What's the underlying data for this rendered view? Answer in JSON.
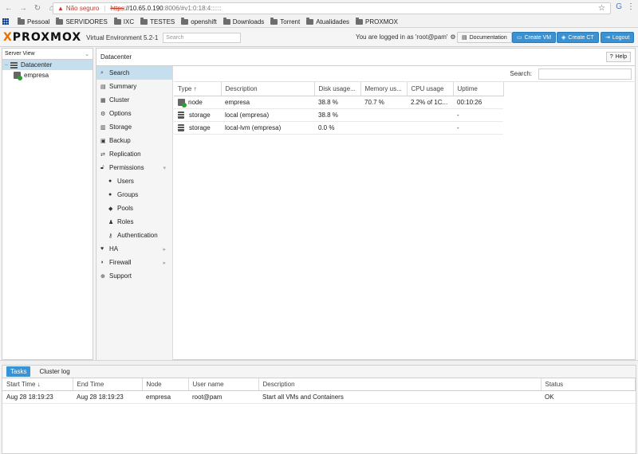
{
  "browser": {
    "insecure_label": "Não seguro",
    "url_scheme": "https",
    "url_host": "://10.65.0.190",
    "url_rest": ":8006/#v1:0:18:4::::::",
    "bookmarks": [
      "Pessoal",
      "SERVIDORES",
      "IXC",
      "TESTES",
      "openshift",
      "Downloads",
      "Torrent",
      "Atualidades",
      "PROXMOX"
    ]
  },
  "header": {
    "logo_pre": "",
    "logo_x": "X",
    "logo_text": "PROXMOX",
    "ve_title": "Virtual Environment 5.2-1",
    "search_placeholder": "Search",
    "logged_in": "You are logged in as 'root@pam'",
    "doc_label": "Documentation",
    "create_vm": "Create VM",
    "create_ct": "Create CT",
    "logout": "Logout"
  },
  "tree": {
    "view": "Server View",
    "datacenter": "Datacenter",
    "node": "empresa"
  },
  "content": {
    "title": "Datacenter",
    "help": "Help",
    "menu": [
      {
        "label": "Search",
        "icon": "search-icon"
      },
      {
        "label": "Summary",
        "icon": "summary-icon"
      },
      {
        "label": "Cluster",
        "icon": "cluster-icon"
      },
      {
        "label": "Options",
        "icon": "gear-icon"
      },
      {
        "label": "Storage",
        "icon": "storage-icon"
      },
      {
        "label": "Backup",
        "icon": "backup-icon"
      },
      {
        "label": "Replication",
        "icon": "replication-icon"
      },
      {
        "label": "Permissions",
        "icon": "unlock-icon"
      },
      {
        "label": "Users",
        "icon": "user-icon"
      },
      {
        "label": "Groups",
        "icon": "users-icon"
      },
      {
        "label": "Pools",
        "icon": "tags-icon"
      },
      {
        "label": "Roles",
        "icon": "male-icon"
      },
      {
        "label": "Authentication",
        "icon": "key-icon"
      },
      {
        "label": "HA",
        "icon": "heartbeat-icon"
      },
      {
        "label": "Firewall",
        "icon": "shield-icon"
      },
      {
        "label": "Support",
        "icon": "support-icon"
      }
    ],
    "search_label": "Search:",
    "columns": [
      "Type ↑",
      "Description",
      "Disk usage...",
      "Memory us...",
      "CPU usage",
      "Uptime"
    ],
    "rows": [
      {
        "type": "node",
        "description": "empresa",
        "disk": "38.8 %",
        "memory": "70.7 %",
        "cpu": "2.2% of 1C...",
        "uptime": "00:10:26"
      },
      {
        "type": "storage",
        "description": "local (empresa)",
        "disk": "38.8 %",
        "memory": "",
        "cpu": "",
        "uptime": "-"
      },
      {
        "type": "storage",
        "description": "local-lvm (empresa)",
        "disk": "0.0 %",
        "memory": "",
        "cpu": "",
        "uptime": "-"
      }
    ]
  },
  "tasks": {
    "tab_tasks": "Tasks",
    "tab_log": "Cluster log",
    "columns": [
      "Start Time ↓",
      "End Time",
      "Node",
      "User name",
      "Description",
      "Status"
    ],
    "rows": [
      {
        "start": "Aug 28 18:19:23",
        "end": "Aug 28 18:19:23",
        "node": "empresa",
        "user": "root@pam",
        "description": "Start all VMs and Containers",
        "status": "OK"
      }
    ]
  }
}
